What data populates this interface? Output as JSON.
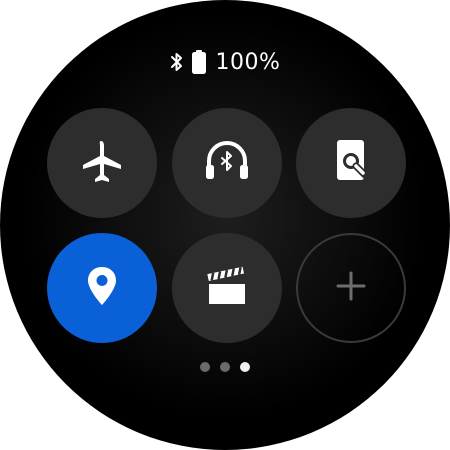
{
  "status_bar": {
    "bluetooth_icon": "bluetooth-icon",
    "battery_icon": "battery-icon",
    "battery_percent_text": "100%",
    "battery_level": 1.0
  },
  "quick_panel": {
    "tiles": [
      {
        "id": "airplane-mode",
        "icon": "airplane-icon",
        "active": false
      },
      {
        "id": "bluetooth-audio",
        "icon": "bluetooth-headphones-icon",
        "active": false
      },
      {
        "id": "find-my-phone",
        "icon": "find-phone-icon",
        "active": false
      },
      {
        "id": "location",
        "icon": "location-pin-icon",
        "active": true
      },
      {
        "id": "theater-mode",
        "icon": "clapperboard-icon",
        "active": false
      },
      {
        "id": "add-tile",
        "icon": "plus-icon",
        "active": false
      }
    ]
  },
  "colors": {
    "background": "#000000",
    "tile_inactive": "#2d2d2d",
    "tile_active": "#0a60d6",
    "icon": "#ffffff",
    "add_outline": "#3a3a3a",
    "page_dot_inactive": "#6a6a6a",
    "page_dot_active": "#f2f2f2"
  },
  "pagination": {
    "total_pages": 3,
    "current_page": 3
  }
}
